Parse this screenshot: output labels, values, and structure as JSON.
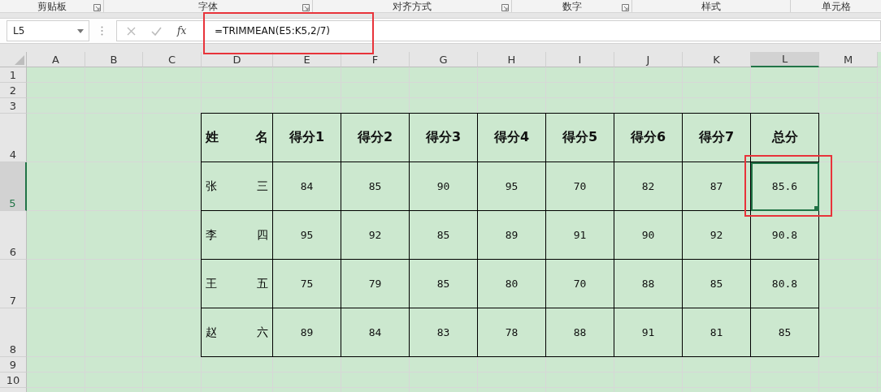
{
  "ribbon_groups": [
    {
      "label": "剪贴板",
      "launcher": true
    },
    {
      "label": "字体",
      "launcher": true
    },
    {
      "label": "对齐方式",
      "launcher": true
    },
    {
      "label": "数字",
      "launcher": true
    },
    {
      "label": "样式",
      "launcher": false
    },
    {
      "label": "单元格",
      "launcher": false
    }
  ],
  "formula_bar": {
    "name_box": "L5",
    "function_label": "fx",
    "formula": "=TRIMMEAN(E5:K5,2/7)",
    "highlighted": true
  },
  "columns": [
    {
      "label": "A",
      "selected": false
    },
    {
      "label": "B",
      "selected": false
    },
    {
      "label": "C",
      "selected": false
    },
    {
      "label": "D",
      "selected": false
    },
    {
      "label": "E",
      "selected": false
    },
    {
      "label": "F",
      "selected": false
    },
    {
      "label": "G",
      "selected": false
    },
    {
      "label": "H",
      "selected": false
    },
    {
      "label": "I",
      "selected": false
    },
    {
      "label": "J",
      "selected": false
    },
    {
      "label": "K",
      "selected": false
    },
    {
      "label": "L",
      "selected": true
    },
    {
      "label": "M",
      "selected": false
    }
  ],
  "row_headers": [
    {
      "label": "1",
      "selected": false
    },
    {
      "label": "2",
      "selected": false
    },
    {
      "label": "3",
      "selected": false
    },
    {
      "label": "4",
      "selected": false
    },
    {
      "label": "5",
      "selected": true
    },
    {
      "label": "6",
      "selected": false
    },
    {
      "label": "7",
      "selected": false
    },
    {
      "label": "8",
      "selected": false
    },
    {
      "label": "9",
      "selected": false
    },
    {
      "label": "10",
      "selected": false
    }
  ],
  "table": {
    "header": [
      "姓 名",
      "得分1",
      "得分2",
      "得分3",
      "得分4",
      "得分5",
      "得分6",
      "得分7",
      "总分"
    ],
    "rows": [
      {
        "name": "张 三",
        "scores": [
          "84",
          "85",
          "90",
          "95",
          "70",
          "82",
          "87"
        ],
        "total": "85.6",
        "total_selected": true,
        "total_highlighted": true
      },
      {
        "name": "李 四",
        "scores": [
          "95",
          "92",
          "85",
          "89",
          "91",
          "90",
          "92"
        ],
        "total": "90.8",
        "total_selected": false,
        "total_highlighted": false
      },
      {
        "name": "王 五",
        "scores": [
          "75",
          "79",
          "85",
          "80",
          "70",
          "88",
          "85"
        ],
        "total": "80.8",
        "total_selected": false,
        "total_highlighted": false
      },
      {
        "name": "赵 六",
        "scores": [
          "89",
          "84",
          "83",
          "78",
          "88",
          "91",
          "81"
        ],
        "total": "85",
        "total_selected": false,
        "total_highlighted": false
      }
    ]
  }
}
